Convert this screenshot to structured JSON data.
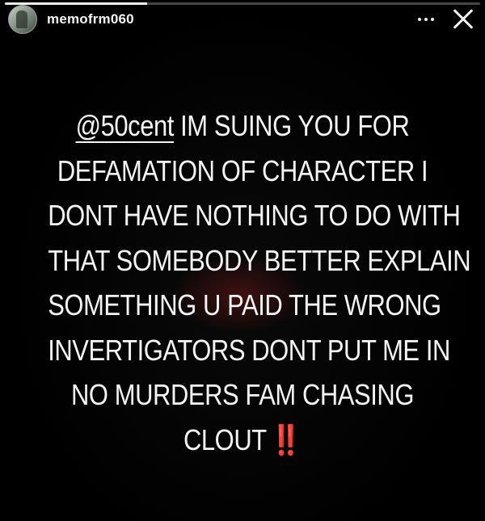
{
  "story": {
    "username": "memofrm060",
    "progress": 0.3,
    "avatar_icon": "profile-avatar",
    "more_icon": "more-horizontal-icon",
    "close_icon": "close-icon"
  },
  "caption": {
    "mention": "@50cent",
    "first_line_rest": " IM SUING YOU FOR",
    "lines": [
      "DEFAMATION OF CHARACTER I",
      "DONT HAVE NOTHING TO DO WITH",
      "THAT SOMEBODY BETTER EXPLAIN",
      "SOMETHING U PAID THE WRONG",
      "INVERTIGATORS DONT PUT ME IN",
      "NO MURDERS FAM CHASING"
    ],
    "last_line": "CLOUT",
    "emoji": "‼️",
    "emoji_color": "#e11e1e"
  }
}
